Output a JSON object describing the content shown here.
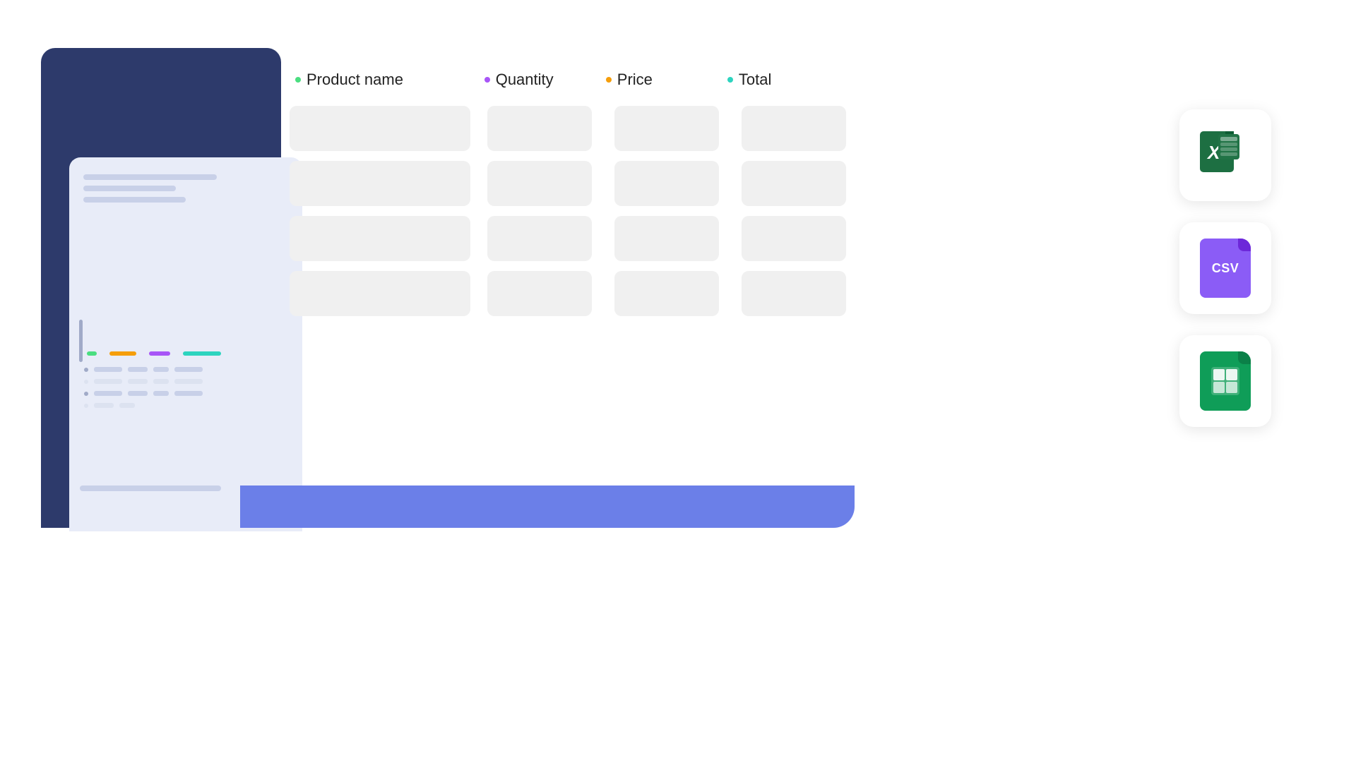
{
  "table": {
    "columns": [
      {
        "id": "product",
        "label": "Product name",
        "dot_class": "dot-green"
      },
      {
        "id": "quantity",
        "label": "Quantity",
        "dot_class": "dot-purple"
      },
      {
        "id": "price",
        "label": "Price",
        "dot_class": "dot-orange"
      },
      {
        "id": "total",
        "label": "Total",
        "dot_class": "dot-teal"
      }
    ],
    "rows": [
      {
        "id": "row1"
      },
      {
        "id": "row2"
      },
      {
        "id": "row3"
      },
      {
        "id": "row4"
      }
    ]
  },
  "icons": [
    {
      "id": "excel",
      "label": "Microsoft Excel",
      "type": "excel"
    },
    {
      "id": "csv",
      "label": "CSV File",
      "type": "csv",
      "text": "CSV"
    },
    {
      "id": "sheets",
      "label": "Google Sheets",
      "type": "sheets"
    }
  ],
  "colors": {
    "green": "#4ade80",
    "purple": "#a855f7",
    "orange": "#f59e0b",
    "teal": "#2dd4bf",
    "dark_bg": "#2d3a6b",
    "light_panel": "#e8ecf8",
    "blue_accent": "#6b7fe8",
    "excel_green": "#1d6f42",
    "csv_purple": "#8b5cf6",
    "sheets_green": "#0f9d58"
  }
}
